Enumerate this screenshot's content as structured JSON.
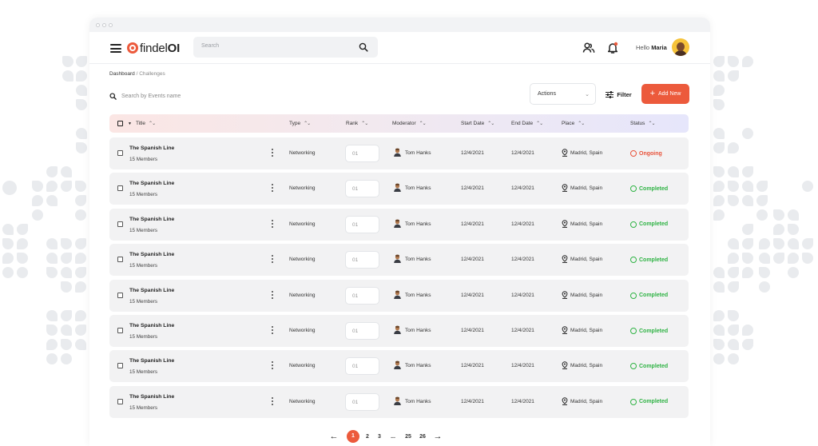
{
  "header": {
    "logo_prefix": "findel",
    "logo_bold": "OI",
    "search_placeholder": "Search",
    "greeting": "Hello",
    "user_name": "Maria"
  },
  "breadcrumb": {
    "root": "Dashboard",
    "separator": " / ",
    "current": "Challenges"
  },
  "toolbar": {
    "event_search_placeholder": "Search by Events name",
    "actions_label": "Actions",
    "filter_label": "Filter",
    "add_label": "Add New"
  },
  "table": {
    "columns": {
      "title": "Title",
      "type": "Type",
      "rank": "Rank",
      "moderator": "Moderator",
      "start_date": "Start Date",
      "end_date": "End Date",
      "place": "Place",
      "status": "Status"
    },
    "rows": [
      {
        "title": "The Spanish Line",
        "members": "15 Members",
        "type": "Networking",
        "rank": "01",
        "moderator": "Tom Hanks",
        "start": "12/4/2021",
        "end": "12/4/2021",
        "place": "Madrid, Spain",
        "status": "Ongoing"
      },
      {
        "title": "The Spanish Line",
        "members": "15 Members",
        "type": "Networking",
        "rank": "01",
        "moderator": "Tom Hanks",
        "start": "12/4/2021",
        "end": "12/4/2021",
        "place": "Madrid, Spain",
        "status": "Completed"
      },
      {
        "title": "The Spanish Line",
        "members": "15 Members",
        "type": "Networking",
        "rank": "01",
        "moderator": "Tom Hanks",
        "start": "12/4/2021",
        "end": "12/4/2021",
        "place": "Madrid, Spain",
        "status": "Completed"
      },
      {
        "title": "The Spanish Line",
        "members": "15 Members",
        "type": "Networking",
        "rank": "01",
        "moderator": "Tom Hanks",
        "start": "12/4/2021",
        "end": "12/4/2021",
        "place": "Madrid, Spain",
        "status": "Completed"
      },
      {
        "title": "The Spanish Line",
        "members": "15 Members",
        "type": "Networking",
        "rank": "01",
        "moderator": "Tom Hanks",
        "start": "12/4/2021",
        "end": "12/4/2021",
        "place": "Madrid, Spain",
        "status": "Completed"
      },
      {
        "title": "The Spanish Line",
        "members": "15 Members",
        "type": "Networking",
        "rank": "01",
        "moderator": "Tom Hanks",
        "start": "12/4/2021",
        "end": "12/4/2021",
        "place": "Madrid, Spain",
        "status": "Completed"
      },
      {
        "title": "The Spanish Line",
        "members": "15 Members",
        "type": "Networking",
        "rank": "01",
        "moderator": "Tom Hanks",
        "start": "12/4/2021",
        "end": "12/4/2021",
        "place": "Madrid, Spain",
        "status": "Completed"
      },
      {
        "title": "The Spanish Line",
        "members": "15 Members",
        "type": "Networking",
        "rank": "01",
        "moderator": "Tom Hanks",
        "start": "12/4/2021",
        "end": "12/4/2021",
        "place": "Madrid, Spain",
        "status": "Completed"
      }
    ]
  },
  "pagination": {
    "pages": [
      "1",
      "2",
      "3",
      "...",
      "25",
      "26"
    ],
    "current": "1",
    "prev_icon": "arrow-left-icon",
    "next_icon": "arrow-right-icon"
  },
  "colors": {
    "accent": "#ec5a3c",
    "ongoing": "#e8523a",
    "completed": "#2fb344"
  },
  "icons": [
    "menu-icon",
    "search-icon",
    "users-icon",
    "bell-icon",
    "filter-icon",
    "plus-icon",
    "sort-icon",
    "more-vertical-icon",
    "location-pin-icon",
    "check-circle-icon",
    "clock-icon"
  ]
}
